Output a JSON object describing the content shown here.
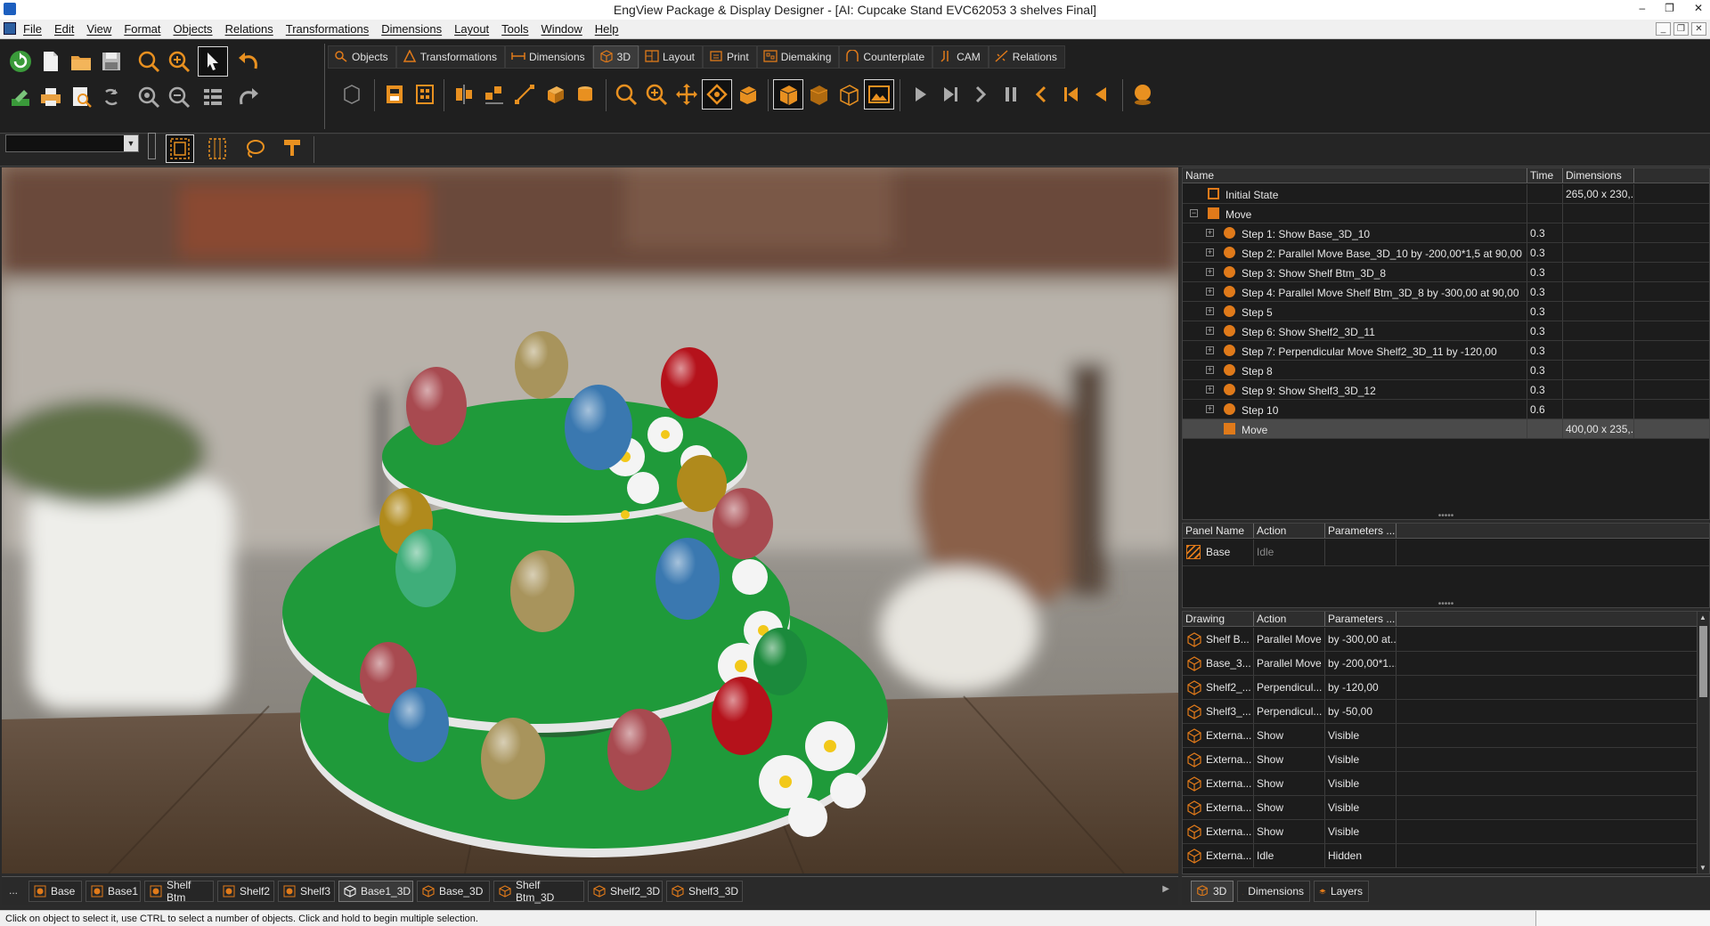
{
  "window": {
    "title": "EngView Package & Display Designer - [AI: Cupcake Stand EVC62053 3 shelves Final]"
  },
  "menu": [
    "File",
    "Edit",
    "View",
    "Format",
    "Objects",
    "Relations",
    "Transformations",
    "Dimensions",
    "Layout",
    "Tools",
    "Window",
    "Help"
  ],
  "ribbon_tabs": [
    {
      "label": "Objects",
      "icon": "objects-icon"
    },
    {
      "label": "Transformations",
      "icon": "transformations-icon"
    },
    {
      "label": "Dimensions",
      "icon": "dimensions-icon"
    },
    {
      "label": "3D",
      "icon": "cube-3d-icon",
      "active": true
    },
    {
      "label": "Layout",
      "icon": "layout-icon"
    },
    {
      "label": "Print",
      "icon": "print-icon"
    },
    {
      "label": "Diemaking",
      "icon": "diemaking-icon"
    },
    {
      "label": "Counterplate",
      "icon": "counterplate-icon"
    },
    {
      "label": "CAM",
      "icon": "cam-icon"
    },
    {
      "label": "Relations",
      "icon": "relations-icon"
    }
  ],
  "steps_grid": {
    "headers": {
      "name": "Name",
      "time": "Time",
      "dimensions": "Dimensions"
    },
    "rows": [
      {
        "name": "Initial State",
        "time": "",
        "dims": "265,00 x 230,...",
        "indent": 0,
        "icon": "box",
        "expander": false
      },
      {
        "name": "Move",
        "time": "",
        "dims": "",
        "indent": 0,
        "icon": "square",
        "expander": true,
        "expander_sign": "−"
      },
      {
        "name": "Step 1: Show Base_3D_10",
        "time": "0.3",
        "dims": "",
        "indent": 1,
        "icon": "dot",
        "expander": true,
        "expander_sign": "+"
      },
      {
        "name": "Step 2: Parallel Move Base_3D_10 by -200,00*1,5 at 90,00",
        "time": "0.3",
        "dims": "",
        "indent": 1,
        "icon": "dot",
        "expander": true,
        "expander_sign": "+"
      },
      {
        "name": "Step 3: Show Shelf Btm_3D_8",
        "time": "0.3",
        "dims": "",
        "indent": 1,
        "icon": "dot",
        "expander": true,
        "expander_sign": "+"
      },
      {
        "name": "Step 4: Parallel Move Shelf Btm_3D_8 by -300,00 at 90,00",
        "time": "0.3",
        "dims": "",
        "indent": 1,
        "icon": "dot",
        "expander": true,
        "expander_sign": "+"
      },
      {
        "name": "Step 5",
        "time": "0.3",
        "dims": "",
        "indent": 1,
        "icon": "dot",
        "expander": true,
        "expander_sign": "+"
      },
      {
        "name": "Step 6: Show Shelf2_3D_11",
        "time": "0.3",
        "dims": "",
        "indent": 1,
        "icon": "dot",
        "expander": true,
        "expander_sign": "+"
      },
      {
        "name": "Step 7: Perpendicular Move Shelf2_3D_11 by -120,00",
        "time": "0.3",
        "dims": "",
        "indent": 1,
        "icon": "dot",
        "expander": true,
        "expander_sign": "+"
      },
      {
        "name": "Step 8",
        "time": "0.3",
        "dims": "",
        "indent": 1,
        "icon": "dot",
        "expander": true,
        "expander_sign": "+"
      },
      {
        "name": "Step 9: Show Shelf3_3D_12",
        "time": "0.3",
        "dims": "",
        "indent": 1,
        "icon": "dot",
        "expander": true,
        "expander_sign": "+"
      },
      {
        "name": "Step 10",
        "time": "0.6",
        "dims": "",
        "indent": 1,
        "icon": "dot",
        "expander": true,
        "expander_sign": "+"
      },
      {
        "name": "Move",
        "time": "",
        "dims": "400,00 x 235,...",
        "indent": 1,
        "icon": "square",
        "expander": false,
        "selected": true
      }
    ]
  },
  "panel_grid": {
    "headers": {
      "panel": "Panel Name",
      "action": "Action",
      "params": "Parameters ..."
    },
    "rows": [
      {
        "panel": "Base",
        "action": "Idle",
        "params": ""
      }
    ]
  },
  "drawing_grid": {
    "headers": {
      "drawing": "Drawing",
      "action": "Action",
      "params": "Parameters ..."
    },
    "rows": [
      {
        "drawing": "Shelf B...",
        "action": "Parallel Move",
        "params": "by -300,00 at..."
      },
      {
        "drawing": "Base_3...",
        "action": "Parallel Move",
        "params": "by -200,00*1..."
      },
      {
        "drawing": "Shelf2_...",
        "action": "Perpendicul...",
        "params": "by -120,00"
      },
      {
        "drawing": "Shelf3_...",
        "action": "Perpendicul...",
        "params": "by -50,00"
      },
      {
        "drawing": "Externa...",
        "action": "Show",
        "params": "Visible"
      },
      {
        "drawing": "Externa...",
        "action": "Show",
        "params": "Visible"
      },
      {
        "drawing": "Externa...",
        "action": "Show",
        "params": "Visible"
      },
      {
        "drawing": "Externa...",
        "action": "Show",
        "params": "Visible"
      },
      {
        "drawing": "Externa...",
        "action": "Show",
        "params": "Visible"
      },
      {
        "drawing": "Externa...",
        "action": "Idle",
        "params": "Hidden"
      }
    ]
  },
  "object_tabs": [
    {
      "label": "Base",
      "kind": "2d"
    },
    {
      "label": "Base1",
      "kind": "2d"
    },
    {
      "label": "Shelf Btm",
      "kind": "2d"
    },
    {
      "label": "Shelf2",
      "kind": "2d"
    },
    {
      "label": "Shelf3",
      "kind": "2d"
    },
    {
      "label": "Base1_3D",
      "kind": "3d",
      "active": true
    },
    {
      "label": "Base_3D",
      "kind": "3d"
    },
    {
      "label": "Shelf Btm_3D",
      "kind": "3d"
    },
    {
      "label": "Shelf2_3D",
      "kind": "3d"
    },
    {
      "label": "Shelf3_3D",
      "kind": "3d"
    }
  ],
  "object_tabs_more": "...",
  "right_tabs": [
    {
      "label": "3D",
      "icon": "cube-3d-icon",
      "active": true
    },
    {
      "label": "Dimensions",
      "icon": "dimensions-icon"
    },
    {
      "label": "Layers",
      "icon": "layers-icon"
    }
  ],
  "status": "Click on object to select it, use CTRL to select a number of objects. Click and hold to begin multiple selection.",
  "colors": {
    "accent": "#e07a1a",
    "shelf_green": "#1f9a3a",
    "egg_red": "#b5121b",
    "egg_blue": "#3a78b0",
    "egg_gold": "#b08a1c",
    "egg_khaki": "#a8945c",
    "egg_rose": "#a84a50",
    "egg_mint": "#3fae7a",
    "egg_green": "#1b8a3c"
  }
}
